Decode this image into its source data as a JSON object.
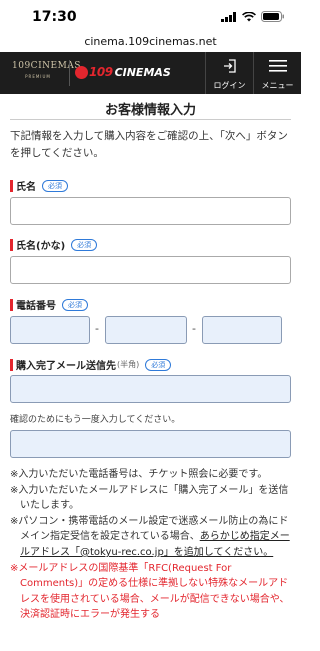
{
  "status": {
    "time": "17:30"
  },
  "browser": {
    "url": "cinema.109cinemas.net"
  },
  "header": {
    "logo_premium_line1": "109CINEMAS",
    "logo_premium_line2": "PREMIUM",
    "logo_main_num": "109",
    "logo_main_text": "CINEMAS",
    "login_label": "ログイン",
    "menu_label": "メニュー"
  },
  "page": {
    "title": "お客様情報入力",
    "intro": "下記情報を入力して購入内容をご確認の上、「次へ」ボタンを押してください。"
  },
  "form": {
    "required_badge": "必須",
    "name_label": "氏名",
    "name_kana_label": "氏名(かな)",
    "phone_label": "電話番号",
    "phone_dash": "-",
    "email_label": "購入完了メール送信先",
    "email_label_note": "(半角)",
    "email_confirm_note": "確認のためにもう一度入力してください。"
  },
  "notes": {
    "n1": "※入力いただいた電話番号は、チケット照会に必要です。",
    "n2": "※入力いただいたメールアドレスに「購入完了メール」を送信いたします。",
    "n3_prefix": "※パソコン・携帯電話のメール設定で迷惑メール防止の為にドメイン指定受信を設定されている場合、",
    "n3_link": "あらかじめ指定メールアドレス「@tokyu-rec.co.jp」を追加してください。",
    "n4": "※メールアドレスの国際基準「RFC(Request For Comments)」の定める仕様に準拠しない特殊なメールアドレスを使用されている場合、メールが配信できない場合や、決済認証時にエラーが発生する"
  },
  "colors": {
    "accent_red": "#e3262e",
    "badge_blue": "#2f7ad9",
    "header_bg": "#1d1d1d",
    "autofill_bg": "#e8f0fb"
  }
}
